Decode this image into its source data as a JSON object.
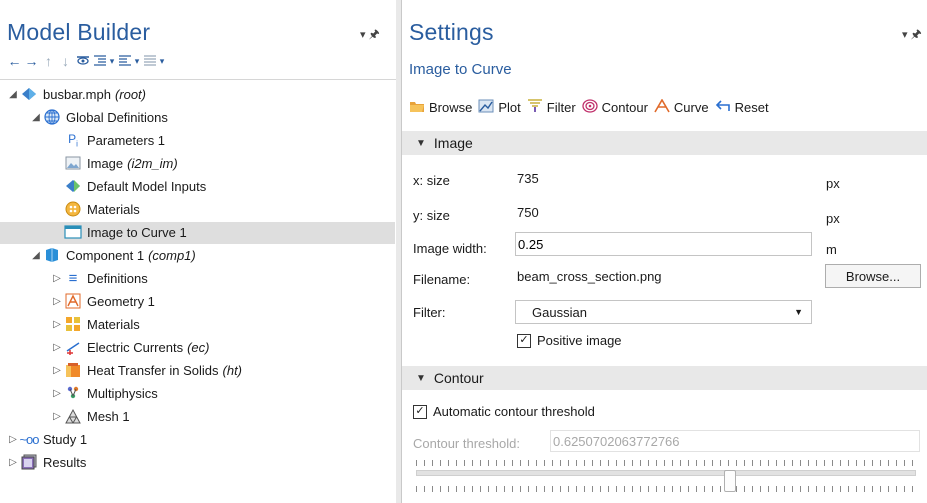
{
  "model_builder": {
    "title": "Model Builder",
    "pin": "▾ ▮",
    "toolbar": [
      "←",
      "→",
      "↑",
      "↓",
      "👁",
      "≡",
      "▾",
      "≡",
      "▾",
      "≡",
      "▾"
    ],
    "tree": [
      {
        "label": "busbar.mph",
        "italic": "(root)",
        "icon": "diamond-icon",
        "twisty": "◢"
      },
      {
        "label": "Global Definitions",
        "italic": "",
        "icon": "globe-icon",
        "twisty": "◢"
      },
      {
        "label": "Parameters 1",
        "italic": "",
        "icon": "parameters-icon",
        "twisty": ""
      },
      {
        "label": "Image",
        "italic": "(i2m_im)",
        "icon": "image-icon",
        "twisty": ""
      },
      {
        "label": "Default Model Inputs",
        "italic": "",
        "icon": "model-inputs-icon",
        "twisty": ""
      },
      {
        "label": "Materials",
        "italic": "",
        "icon": "materials-icon",
        "twisty": ""
      },
      {
        "label": "Image to Curve 1",
        "italic": "",
        "icon": "curve-node-icon",
        "twisty": ""
      },
      {
        "label": "Component 1",
        "italic": "(comp1)",
        "icon": "component-icon",
        "twisty": "◢"
      },
      {
        "label": "Definitions",
        "italic": "",
        "icon": "definitions-icon",
        "twisty": "▷"
      },
      {
        "label": "Geometry 1",
        "italic": "",
        "icon": "geometry-icon",
        "twisty": "▷"
      },
      {
        "label": "Materials",
        "italic": "",
        "icon": "materials-grid-icon",
        "twisty": "▷"
      },
      {
        "label": "Electric Currents",
        "italic": "(ec)",
        "icon": "electric-currents-icon",
        "twisty": "▷"
      },
      {
        "label": "Heat Transfer in Solids",
        "italic": "(ht)",
        "icon": "heat-transfer-icon",
        "twisty": "▷"
      },
      {
        "label": "Multiphysics",
        "italic": "",
        "icon": "multiphysics-icon",
        "twisty": "▷"
      },
      {
        "label": "Mesh 1",
        "italic": "",
        "icon": "mesh-icon",
        "twisty": "▷"
      },
      {
        "label": "Study 1",
        "italic": "",
        "icon": "study-icon",
        "twisty": "▷"
      },
      {
        "label": "Results",
        "italic": "",
        "icon": "results-icon",
        "twisty": "▷"
      }
    ]
  },
  "settings": {
    "title": "Settings",
    "pin": "▾ ▮",
    "subtitle": "Image to Curve",
    "toolbar": {
      "browse": "Browse",
      "plot": "Plot",
      "filter": "Filter",
      "contour": "Contour",
      "curve": "Curve",
      "reset": "Reset"
    },
    "image_section": {
      "header": "Image",
      "x_size_label": "x: size",
      "x_size_value": "735",
      "x_size_unit": "px",
      "y_size_label": "y: size",
      "y_size_value": "750",
      "y_size_unit": "px",
      "width_label": "Image width:",
      "width_value": "0.25",
      "width_unit": "m",
      "filename_label": "Filename:",
      "filename_value": "beam_cross_section.png",
      "browse_button": "Browse...",
      "filter_label": "Filter:",
      "filter_value": "Gaussian",
      "positive_image_label": "Positive image",
      "positive_image_checked": true
    },
    "contour_section": {
      "header": "Contour",
      "auto_threshold_label": "Automatic contour threshold",
      "auto_threshold_checked": true,
      "threshold_label": "Contour threshold:",
      "threshold_value": "0.6250702063772766",
      "slider_value": 0.625
    }
  },
  "colors": {
    "title_blue": "#2a5d9f",
    "selection": "#dedede",
    "section_header": "#e8e8e8"
  }
}
